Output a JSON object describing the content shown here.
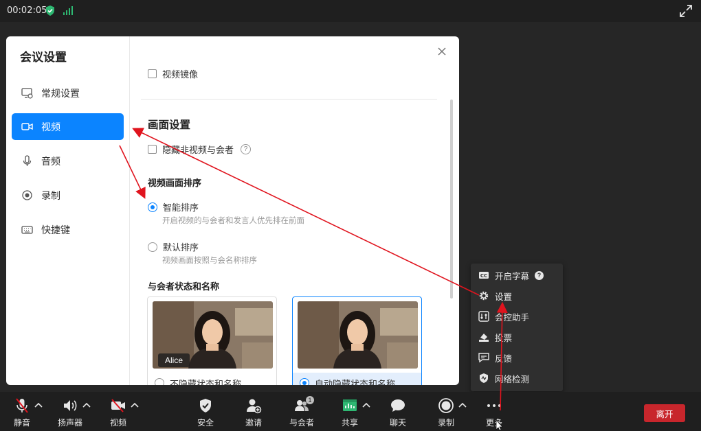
{
  "topbar": {
    "timer": "00:02:05"
  },
  "dialog": {
    "title": "会议设置",
    "nav": [
      {
        "label": "常规设置"
      },
      {
        "label": "视频"
      },
      {
        "label": "音频"
      },
      {
        "label": "录制"
      },
      {
        "label": "快捷键"
      }
    ],
    "mirror_label": "视频镜像",
    "section_title": "画面设置",
    "hide_nonvideo_label": "隐藏非视频与会者",
    "order_title": "视频画面排序",
    "smart_order_label": "智能排序",
    "smart_order_hint": "开启视频的与会者和发言人优先排在前面",
    "default_order_label": "默认排序",
    "default_order_hint": "视频画面按照与会名称排序",
    "status_title": "与会者状态和名称",
    "card1_name": "Alice",
    "card1_label": "不隐藏状态和名称",
    "card2_label": "自动隐藏状态和名称"
  },
  "menu": {
    "items": [
      {
        "label": "开启字幕"
      },
      {
        "label": "设置"
      },
      {
        "label": "会控助手"
      },
      {
        "label": "投票"
      },
      {
        "label": "反馈"
      },
      {
        "label": "网络检测"
      }
    ]
  },
  "toolbar": {
    "mute": "静音",
    "speaker": "扬声器",
    "video": "视频",
    "security": "安全",
    "invite": "邀请",
    "participants": "与会者",
    "participants_count": "1",
    "share": "共享",
    "chat": "聊天",
    "record": "录制",
    "more": "更多",
    "leave": "离开"
  },
  "colors": {
    "accent": "#0b84ff",
    "leave": "#c8262c",
    "annotation": "#e0141e"
  }
}
